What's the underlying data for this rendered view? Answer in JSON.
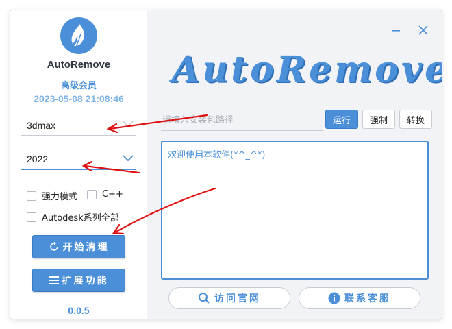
{
  "app": {
    "name": "AutoRemove",
    "member_level": "高级会员",
    "datetime": "2023-05-08 21:08:46",
    "version": "0.0.5",
    "banner_title": "AutoRemove"
  },
  "left": {
    "software_select": "3dmax",
    "version_select": "2022",
    "options": [
      {
        "label": "强力模式",
        "checked": false
      },
      {
        "label": "C++",
        "checked": false
      },
      {
        "label": "Autodesk系列全部",
        "checked": false
      }
    ],
    "start_button": "开始清理",
    "extend_button": "扩展功能"
  },
  "main": {
    "path_placeholder": "请填入安装包路径",
    "run_button": "运行",
    "force_button": "强制",
    "convert_button": "转换",
    "log_text": "欢迎使用本软件(*^_^*)",
    "visit_site_button": "访问官网",
    "contact_button": "联系客服"
  },
  "colors": {
    "accent": "#4a8fd8",
    "annotation_arrow": "#e01010"
  },
  "icons": {
    "logo": "flame-leaf-icon",
    "start": "refresh-icon",
    "extend": "menu-icon",
    "visit": "search-icon",
    "contact": "info-icon",
    "minimize": "minimize-icon",
    "close": "close-icon"
  }
}
